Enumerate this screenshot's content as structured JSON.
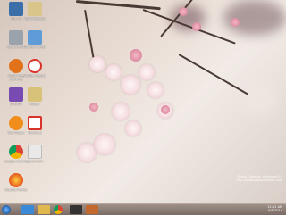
{
  "desktop": {
    "icons": [
      {
        "label": "This PC",
        "icon": "computer-icon",
        "color": "#3b6fa8"
      },
      {
        "label": "Administrator",
        "icon": "user-folder-icon",
        "color": "#d9c48a"
      },
      {
        "label": "Recycle Bin",
        "icon": "recycle-bin-icon",
        "color": "#9aa3ab"
      },
      {
        "label": "Control Panel",
        "icon": "control-panel-icon",
        "color": "#5f9bd6"
      },
      {
        "label": "Avast Free Antivirus",
        "icon": "avast-icon",
        "color": "#e2721a"
      },
      {
        "label": "Adobe Reader",
        "icon": "pdf-icon",
        "color": "#d9342b"
      },
      {
        "label": "WinRAR",
        "icon": "winrar-icon",
        "color": "#7a4ab3"
      },
      {
        "label": "Folder",
        "icon": "folder-icon",
        "color": "#d8c27a"
      },
      {
        "label": "VLC Player",
        "icon": "vlc-icon",
        "color": "#f08d1b"
      },
      {
        "label": "Shortcut",
        "icon": "shortcut-icon",
        "color": "#d9342b"
      },
      {
        "label": "Google Chrome",
        "icon": "chrome-icon",
        "color": "#4c9a3a"
      },
      {
        "label": "Document",
        "icon": "document-icon",
        "color": "#e9e9e9"
      },
      {
        "label": "Mozilla Firefox",
        "icon": "firefox-icon",
        "color": "#e3561d"
      }
    ],
    "watermark_line1": "Photo Glass for Windows 8.1",
    "watermark_line2": "http://www.glassdesktop.com"
  },
  "taskbar": {
    "items": [
      {
        "icon": "ie-icon",
        "color": "#3b8ad8"
      },
      {
        "icon": "explorer-icon",
        "color": "#e0b84d"
      },
      {
        "icon": "chrome-icon",
        "color": "#4c9a3a"
      },
      {
        "icon": "media-icon",
        "color": "#333333"
      },
      {
        "icon": "app-icon",
        "color": "#c2692f"
      }
    ],
    "time": "11:11 AM",
    "date": "6/5/2014"
  }
}
